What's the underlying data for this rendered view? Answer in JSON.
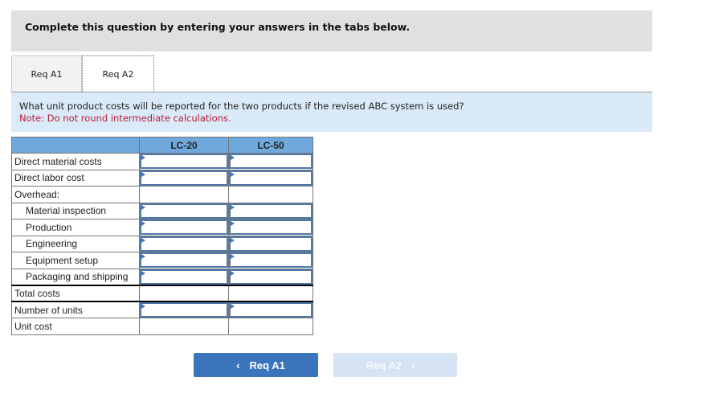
{
  "instructions": "Complete this question by entering your answers in the tabs below.",
  "tabs": [
    {
      "label": "Req A1",
      "active": false
    },
    {
      "label": "Req A2",
      "active": true
    }
  ],
  "question": {
    "text": "What unit product costs will be reported for the two products if the revised ABC system is used?",
    "note": "Note: Do not round intermediate calculations."
  },
  "table": {
    "columns": [
      "",
      "LC-20",
      "LC-50"
    ],
    "rows": [
      {
        "label": "Direct material costs",
        "indent": false,
        "input": true,
        "values": [
          "",
          ""
        ]
      },
      {
        "label": "Direct labor cost",
        "indent": false,
        "input": true,
        "values": [
          "",
          ""
        ]
      },
      {
        "label": "Overhead:",
        "indent": false,
        "input": false,
        "values": [
          "",
          ""
        ]
      },
      {
        "label": "Material inspection",
        "indent": true,
        "input": true,
        "values": [
          "",
          ""
        ]
      },
      {
        "label": "Production",
        "indent": true,
        "input": true,
        "values": [
          "",
          ""
        ]
      },
      {
        "label": "Engineering",
        "indent": true,
        "input": true,
        "values": [
          "",
          ""
        ]
      },
      {
        "label": "Equipment setup",
        "indent": true,
        "input": true,
        "values": [
          "",
          ""
        ]
      },
      {
        "label": "Packaging and shipping",
        "indent": true,
        "input": true,
        "values": [
          "",
          ""
        ]
      },
      {
        "label": "Total costs",
        "indent": false,
        "input": false,
        "values": [
          "",
          ""
        ]
      },
      {
        "label": "Number of units",
        "indent": false,
        "input": true,
        "values": [
          "",
          ""
        ]
      },
      {
        "label": "Unit cost",
        "indent": false,
        "input": false,
        "values": [
          "",
          ""
        ]
      }
    ]
  },
  "nav": {
    "prev_label": "Req A1",
    "prev_icon": "‹",
    "next_label": "Req A2",
    "next_icon": "›"
  },
  "colors": {
    "header_bg": "#6fa8dc",
    "input_border": "#4f79a8",
    "note_red": "#b3203a",
    "prev_button": "#3a75bb",
    "next_button_disabled": "#d6e3f2"
  }
}
